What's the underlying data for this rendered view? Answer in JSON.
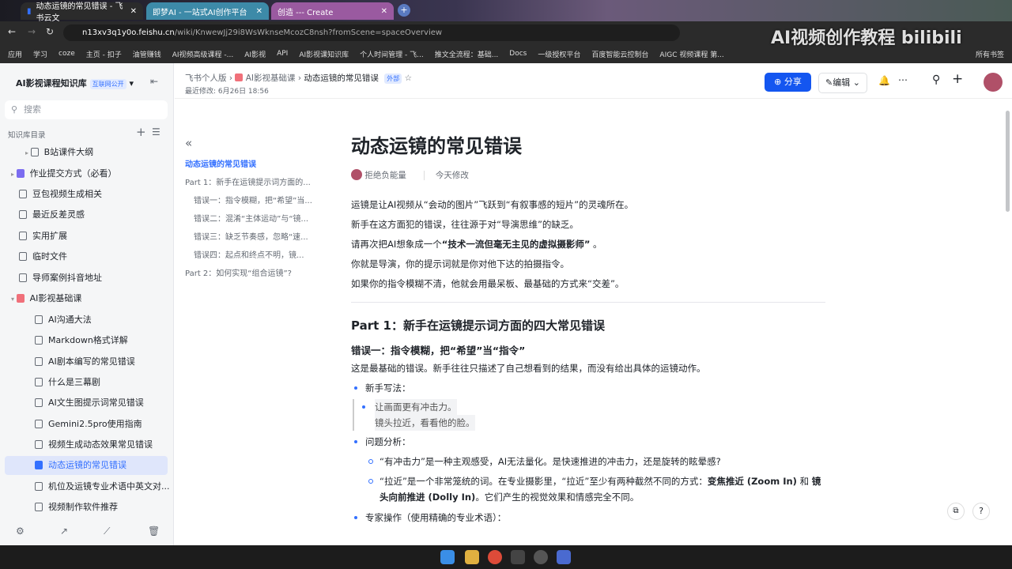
{
  "browser": {
    "tabs": [
      {
        "title": "动态运镜的常见错误 - 飞书云文"
      },
      {
        "title": "即梦AI - 一站式AI创作平台"
      },
      {
        "title": "创造 --- Create"
      }
    ],
    "url_host": "n13xv3q1y0o.feishu.cn",
    "url_path": "/wiki/KnwewJj29i8WsWknseMcozC8nsh?fromScene=spaceOverview",
    "bookmarks": [
      "应用",
      "学习",
      "coze",
      "主页 - 扣子",
      "油管赚钱",
      "AI视频高级课程 -...",
      "AI影视",
      "API",
      "AI影视课知识库",
      "个人时间管理 - 飞...",
      "推文全流程：基础...",
      "Docs",
      "一级授权平台",
      "百度智能云控制台",
      "AIGC 视频课程 第...",
      "所有书签"
    ],
    "watermark": "AI视频创作教程 bilibili"
  },
  "sidebar": {
    "title": "AI影视课程知识库",
    "badge": "互联网公开",
    "search_placeholder": "搜索",
    "section": "知识库目录",
    "items": [
      {
        "label": "B站课件大纲"
      },
      {
        "label": "作业提交方式（必看）"
      },
      {
        "label": "豆包视频生成相关"
      },
      {
        "label": "最近反差灵感"
      },
      {
        "label": "实用扩展"
      },
      {
        "label": "临时文件"
      },
      {
        "label": "导师案例抖音地址"
      },
      {
        "label": "AI影视基础课"
      },
      {
        "label": "AI沟通大法"
      },
      {
        "label": "Markdown格式详解"
      },
      {
        "label": "AI剧本编写的常见错误"
      },
      {
        "label": "什么是三幕剧"
      },
      {
        "label": "AI文生图提示词常见错误"
      },
      {
        "label": "Gemini2.5pro使用指南"
      },
      {
        "label": "视频生成动态效果常见错误"
      },
      {
        "label": "动态运镜的常见错误"
      },
      {
        "label": "机位及运镜专业术语中英文对..."
      },
      {
        "label": "视频制作软件推荐"
      }
    ]
  },
  "header": {
    "breadcrumb": [
      "飞书个人版",
      "AI影视基础课",
      "动态运镜的常见错误"
    ],
    "tag": "外部",
    "modified": "最近修改: 6月26日 18:56",
    "share": "分享",
    "edit": "编辑"
  },
  "toc": [
    "动态运镜的常见错误",
    "Part 1：新手在运镜提示词方面的...",
    "错误一：指令模糊，把“希望”当...",
    "错误二：混淆“主体运动”与“镜...",
    "错误三：缺乏节奏感，忽略“速...",
    "错误四：起点和终点不明，镜...",
    "Part 2：如何实现“组合运镜”?"
  ],
  "doc": {
    "title": "动态运镜的常见错误",
    "author": "拒绝负能量",
    "modified": "今天修改",
    "intro": [
      "运镜是让AI视频从“会动的图片”飞跃到“有叙事感的短片”的灵魂所在。",
      "新手在这方面犯的错误，往往源于对“导演思维”的缺乏。"
    ],
    "intro3_pre": "请再次把AI想象成一个",
    "intro3_bold": "“技术一流但毫无主见的虚拟摄影师”",
    "intro3_post": " 。",
    "intro4": "你就是导演，你的提示词就是你对他下达的拍摄指令。",
    "intro5": "如果你的指令模糊不清，他就会用最呆板、最基础的方式来“交差”。",
    "h2": "Part 1：新手在运镜提示词方面的四大常见错误",
    "h3": "错误一：指令模糊，把“希望”当“指令”",
    "p1": "这是最基础的错误。新手往往只描述了自己想看到的结果，而没有给出具体的运镜动作。",
    "novice": "新手写法：",
    "quote1": "让画面更有冲击力。",
    "quote2": "镜头拉近，看看他的脸。",
    "analysis": "问题分析：",
    "a1": "“有冲击力”是一种主观感受，AI无法量化。是快速推进的冲击力，还是旋转的眩晕感?",
    "a2_pre": "“拉近”是一个非常笼统的词。在专业摄影里，“拉近”至少有两种截然不同的方式：",
    "a2_b1": "变焦推近 (Zoom In)",
    "a2_mid": " 和 ",
    "a2_b2": "镜头向前推进 (Dolly In)",
    "a2_post": "。它们产生的视觉效果和情感完全不同。",
    "expert": "专家操作（使用精确的专业术语）："
  }
}
